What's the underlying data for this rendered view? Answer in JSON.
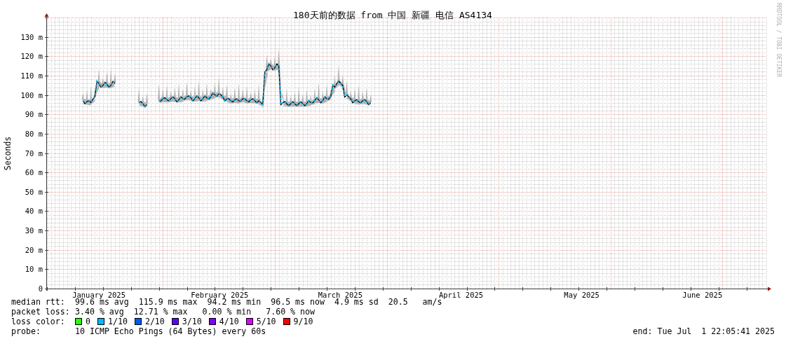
{
  "chart": {
    "title": "180天前的数据 from 中国 新疆 电信 AS4134",
    "ylabel": "Seconds",
    "side_text": "RRDTOOL / TOBI OETIKER",
    "y_tick_labels": [
      "130 m",
      "120 m",
      "110 m",
      "100 m",
      "90 m",
      "80 m",
      "70 m",
      "60 m",
      "50 m",
      "40 m",
      "30 m",
      "20 m",
      "10 m",
      "0"
    ],
    "month_labels": [
      "January 2025",
      "February 2025",
      "March 2025",
      "April 2025",
      "May 2025",
      "June 2025"
    ]
  },
  "legend": [
    {
      "label": "median rtt:",
      "text": "99.6 ms avg  115.9 ms max  94.2 ms min  96.5 ms now  4.9 ms sd  20.5   am/s"
    },
    {
      "label": "packet loss:",
      "text": "3.40 % avg  12.71 % max   0.00 % min   7.60 % now"
    }
  ],
  "loss_color": {
    "label": "loss color:",
    "items": [
      {
        "text": "0",
        "color": "#26ff00"
      },
      {
        "text": "1/10",
        "color": "#00b8ff"
      },
      {
        "text": "2/10",
        "color": "#0059ff"
      },
      {
        "text": "3/10",
        "color": "#5e00ff"
      },
      {
        "text": "4/10",
        "color": "#7e00ff"
      },
      {
        "text": "5/10",
        "color": "#dd00ff"
      },
      {
        "text": "9/10",
        "color": "#ff0000"
      }
    ]
  },
  "probe": {
    "label": "probe:",
    "text": "10 ICMP Echo Pings (64 Bytes) every 60s"
  },
  "end": "end: Tue Jul  1 22:05:41 2025"
}
